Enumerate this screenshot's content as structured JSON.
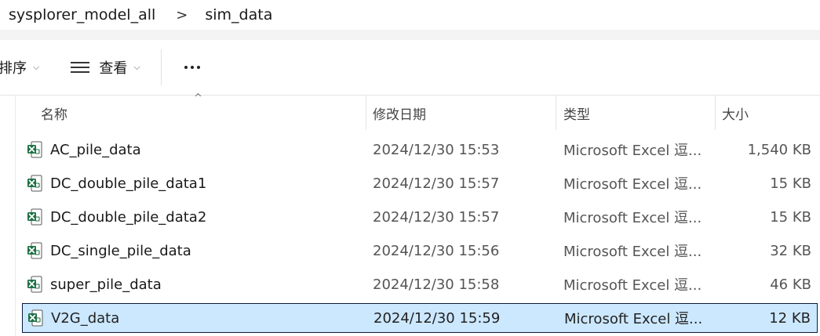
{
  "breadcrumb": {
    "parent": "sysplorer_model_all",
    "separator": ">",
    "current": "sim_data"
  },
  "toolbar": {
    "sort_label": "排序",
    "view_label": "查看",
    "chevron": "⌵"
  },
  "columns": {
    "name": "名称",
    "date": "修改日期",
    "type": "类型",
    "size": "大小",
    "sort_indicator": "^"
  },
  "files": [
    {
      "name": "AC_pile_data",
      "date": "2024/12/30 15:53",
      "type": "Microsoft Excel 逗...",
      "size": "1,540 KB",
      "selected": false
    },
    {
      "name": "DC_double_pile_data1",
      "date": "2024/12/30 15:57",
      "type": "Microsoft Excel 逗...",
      "size": "15 KB",
      "selected": false
    },
    {
      "name": "DC_double_pile_data2",
      "date": "2024/12/30 15:57",
      "type": "Microsoft Excel 逗...",
      "size": "15 KB",
      "selected": false
    },
    {
      "name": "DC_single_pile_data",
      "date": "2024/12/30 15:56",
      "type": "Microsoft Excel 逗...",
      "size": "32 KB",
      "selected": false
    },
    {
      "name": "super_pile_data",
      "date": "2024/12/30 15:58",
      "type": "Microsoft Excel 逗...",
      "size": "46 KB",
      "selected": false
    },
    {
      "name": "V2G_data",
      "date": "2024/12/30 15:59",
      "type": "Microsoft Excel 逗...",
      "size": "12 KB",
      "selected": true
    }
  ],
  "icons": {
    "file": "excel-csv-file-icon",
    "view": "list-lines-icon",
    "more": "more-dots-icon"
  },
  "colors": {
    "excel_green": "#1e7145",
    "selection_bg": "#cce8ff",
    "selection_border": "#0a1a3a"
  }
}
